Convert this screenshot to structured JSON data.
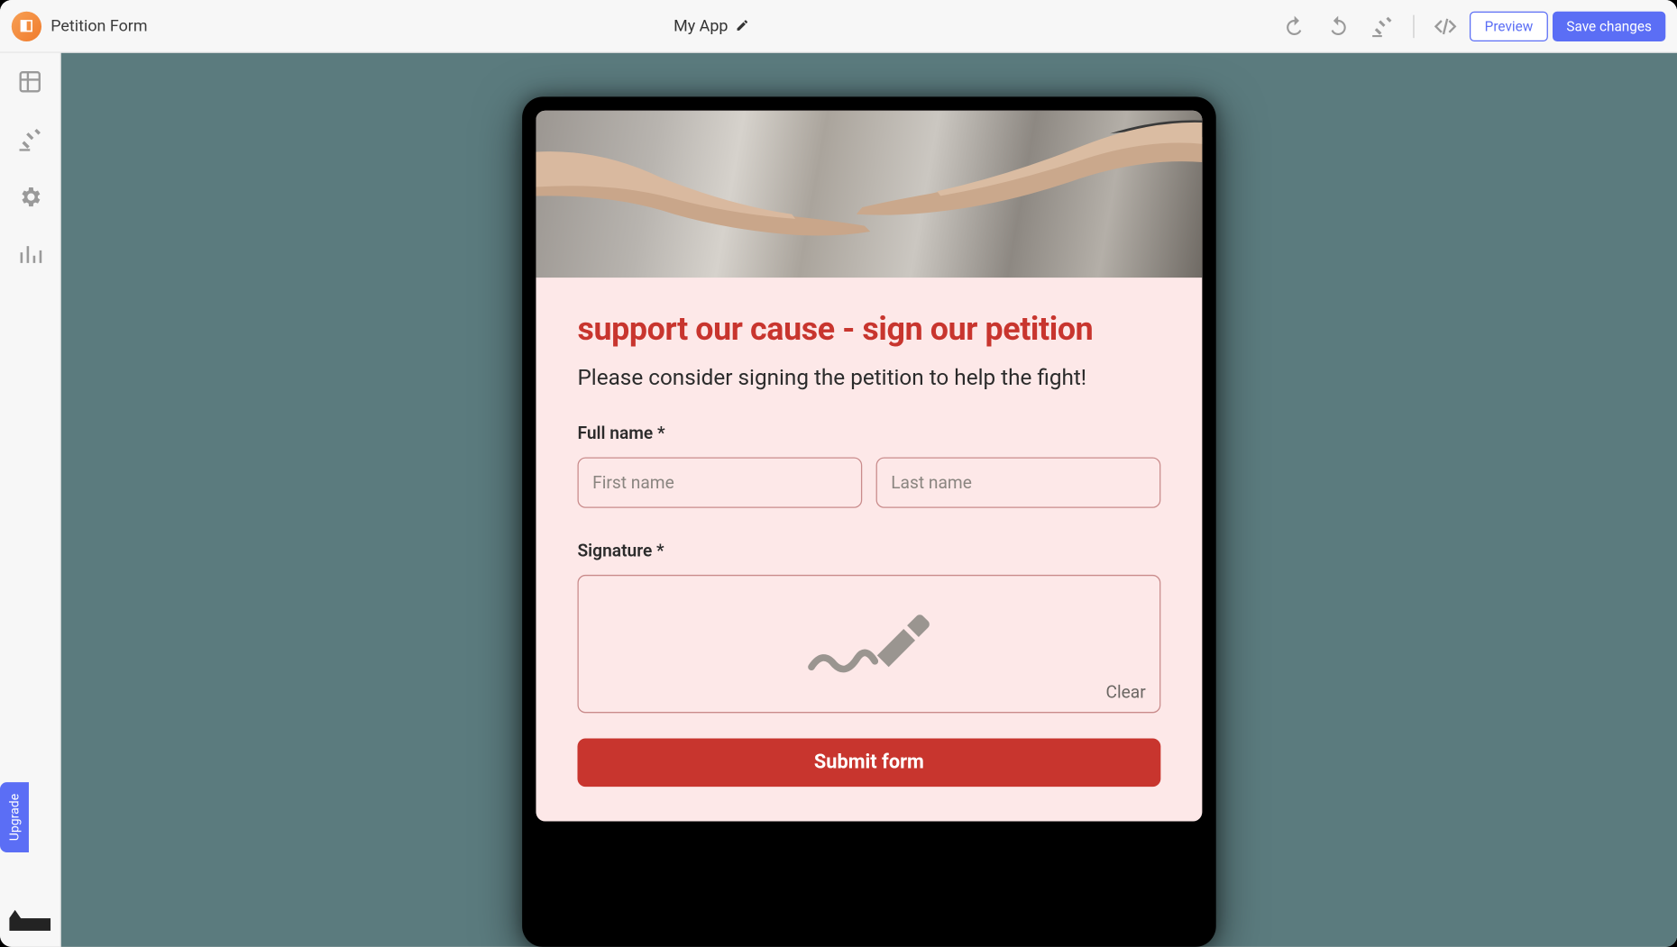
{
  "header": {
    "page_title": "Petition Form",
    "app_name": "My App",
    "preview_label": "Preview",
    "save_label": "Save changes"
  },
  "sidebar": {
    "upgrade_label": "Upgrade"
  },
  "form": {
    "heading": "support our cause - sign our petition",
    "subheading": "Please consider signing the petition to help the fight!",
    "fullname_label": "Full name *",
    "first_placeholder": "First name",
    "last_placeholder": "Last name",
    "signature_label": "Signature *",
    "clear_label": "Clear",
    "submit_label": "Submit form"
  }
}
